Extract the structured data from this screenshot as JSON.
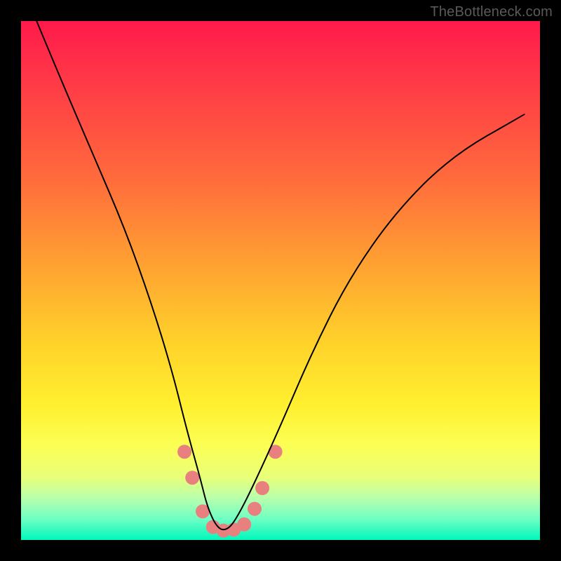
{
  "watermark": "TheBottleneck.com",
  "chart_data": {
    "type": "line",
    "title": "",
    "xlabel": "",
    "ylabel": "",
    "xlim": [
      0,
      100
    ],
    "ylim": [
      0,
      100
    ],
    "grid": false,
    "legend": false,
    "series": [
      {
        "name": "bottleneck-curve",
        "x": [
          3,
          8,
          14,
          20,
          25,
          29,
          32,
          34.5,
          36,
          38,
          40,
          42,
          45,
          50,
          56,
          63,
          72,
          83,
          97
        ],
        "y": [
          100,
          88,
          74,
          60,
          46,
          33,
          21,
          12,
          6,
          2,
          2,
          5,
          11,
          22,
          36,
          50,
          63,
          74,
          82
        ],
        "color": "#000000",
        "stroke_width": 2
      }
    ],
    "markers": [
      {
        "x": 31.5,
        "y": 17,
        "r": 10,
        "color": "#e98080"
      },
      {
        "x": 33.0,
        "y": 12,
        "r": 10,
        "color": "#e98080"
      },
      {
        "x": 35.0,
        "y": 5.5,
        "r": 10,
        "color": "#e98080"
      },
      {
        "x": 37.0,
        "y": 2.5,
        "r": 10,
        "color": "#e98080"
      },
      {
        "x": 39.0,
        "y": 1.8,
        "r": 10,
        "color": "#e98080"
      },
      {
        "x": 41.0,
        "y": 2.0,
        "r": 10,
        "color": "#e98080"
      },
      {
        "x": 43.0,
        "y": 3.0,
        "r": 10,
        "color": "#e98080"
      },
      {
        "x": 45.0,
        "y": 6.0,
        "r": 10,
        "color": "#e98080"
      },
      {
        "x": 46.5,
        "y": 10,
        "r": 10,
        "color": "#e98080"
      },
      {
        "x": 49.0,
        "y": 17,
        "r": 10,
        "color": "#e98080"
      }
    ]
  }
}
